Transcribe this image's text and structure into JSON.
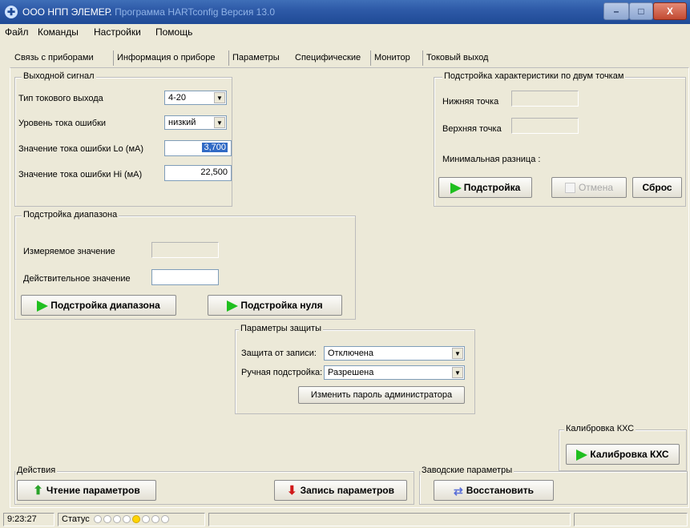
{
  "window": {
    "title_main": "ООО НПП ЭЛЕМЕР.",
    "title_rest": "Программа  HARTconfig   Версия 13.0",
    "min_label": "–",
    "max_label": "□",
    "close_label": "X"
  },
  "menu": [
    "Файл",
    "Команды",
    "Настройки",
    "Помощь"
  ],
  "tabs": [
    "Связь с приборами",
    "Информация о приборе",
    "Параметры",
    "Специфические",
    "Монитор",
    "Токовый выход"
  ],
  "active_tab": "Специфические",
  "output_signal": {
    "legend": "Выходной сигнал",
    "current_type_label": "Тип токового выхода",
    "current_type_value": "4-20",
    "error_level_label": "Уровень тока ошибки",
    "error_level_value": "низкий",
    "error_lo_label": "Значение тока ошибки Lo (мА)",
    "error_lo_value": "3,700",
    "error_hi_label": "Значение тока ошибки Hi (мА)",
    "error_hi_value": "22,500"
  },
  "two_point": {
    "legend": "Подстройка характеристики по двум точкам",
    "lower_label": "Нижняя точка",
    "upper_label": "Верхняя точка",
    "min_diff_label": "Минимальная разница :",
    "tune_button": "Подстройка",
    "cancel_button": "Отмена",
    "reset_button": "Сброс"
  },
  "range_tune": {
    "legend": "Подстройка диапазона",
    "measured_label": "Измеряемое значение",
    "actual_label": "Действительное значение",
    "range_button": "Подстройка диапазона",
    "zero_button": "Подстройка нуля"
  },
  "protection": {
    "legend": "Параметры защиты",
    "write_label": "Защита от записи:",
    "write_value": "Отключена",
    "manual_label": "Ручная подстройка:",
    "manual_value": "Разрешена",
    "change_pw_button": "Изменить пароль администратора"
  },
  "kxs": {
    "legend": "Калибровка КХС",
    "button": "Калибровка КХС"
  },
  "actions": {
    "legend": "Действия",
    "read_button": "Чтение параметров",
    "write_button": "Запись параметров"
  },
  "factory": {
    "legend": "Заводские параметры",
    "restore_button": "Восстановить"
  },
  "status": {
    "time": "9:23:27",
    "label": "Статус",
    "indicators_total": 8,
    "active_index": 4
  },
  "icons": {
    "play": "green-play-icon",
    "read": "green-up-arrow-icon",
    "write": "red-down-arrow-icon",
    "restore": "blue-swap-arrow-icon"
  },
  "colors": {
    "title_bar": "#2e5aa8",
    "play_green": "#1fbf1f",
    "selection": "#316ac5",
    "indicator_active": "#ffd400"
  }
}
